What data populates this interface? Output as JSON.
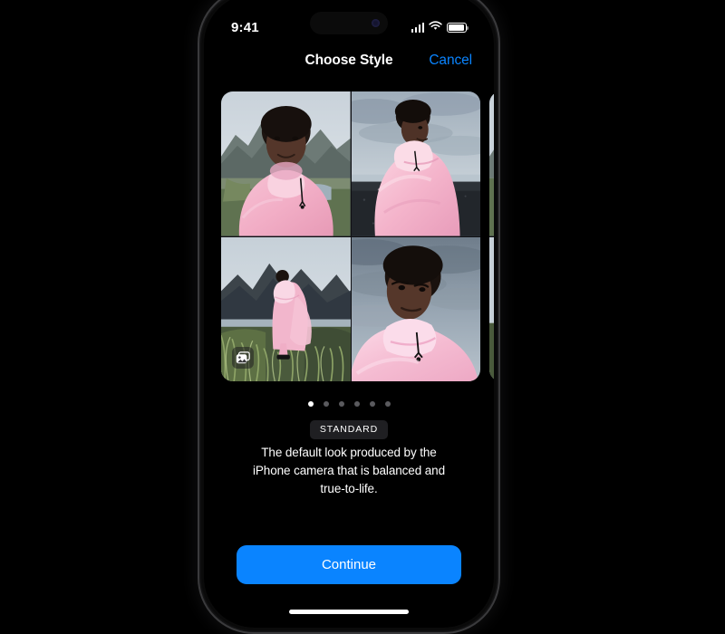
{
  "status_bar": {
    "time": "9:41",
    "cellular_icon": "cellular-signal-icon",
    "wifi_icon": "wifi-icon",
    "battery_icon": "battery-icon",
    "dynamic_island": "dynamic-island"
  },
  "nav": {
    "title": "Choose Style",
    "cancel_label": "Cancel"
  },
  "carousel": {
    "photo_badge_icon": "photo-stack-icon",
    "cards": [
      {
        "name": "standard-style-card",
        "tiles": [
          "portrait-selfie-mountains",
          "portrait-standing-black-beach",
          "full-body-grass-mountains",
          "portrait-closeup-cloudy-sky"
        ]
      },
      {
        "name": "next-style-card",
        "tiles": [
          "portrait-selfie-mountains",
          "portrait-standing-black-beach",
          "full-body-grass-mountains",
          "portrait-closeup-cloudy-sky"
        ]
      }
    ]
  },
  "page_indicator": {
    "total": 6,
    "active_index": 0
  },
  "style": {
    "name": "STANDARD",
    "description": "The default look produced by the iPhone camera that is balanced and true-to-life."
  },
  "footer": {
    "continue_label": "Continue",
    "home_indicator": "home-indicator"
  },
  "colors": {
    "accent_blue": "#0A84FF",
    "screen_background": "#000000",
    "pill_background": "#1F1F22",
    "dot_inactive": "#5A5A5E",
    "dot_active": "#FFFFFF"
  }
}
